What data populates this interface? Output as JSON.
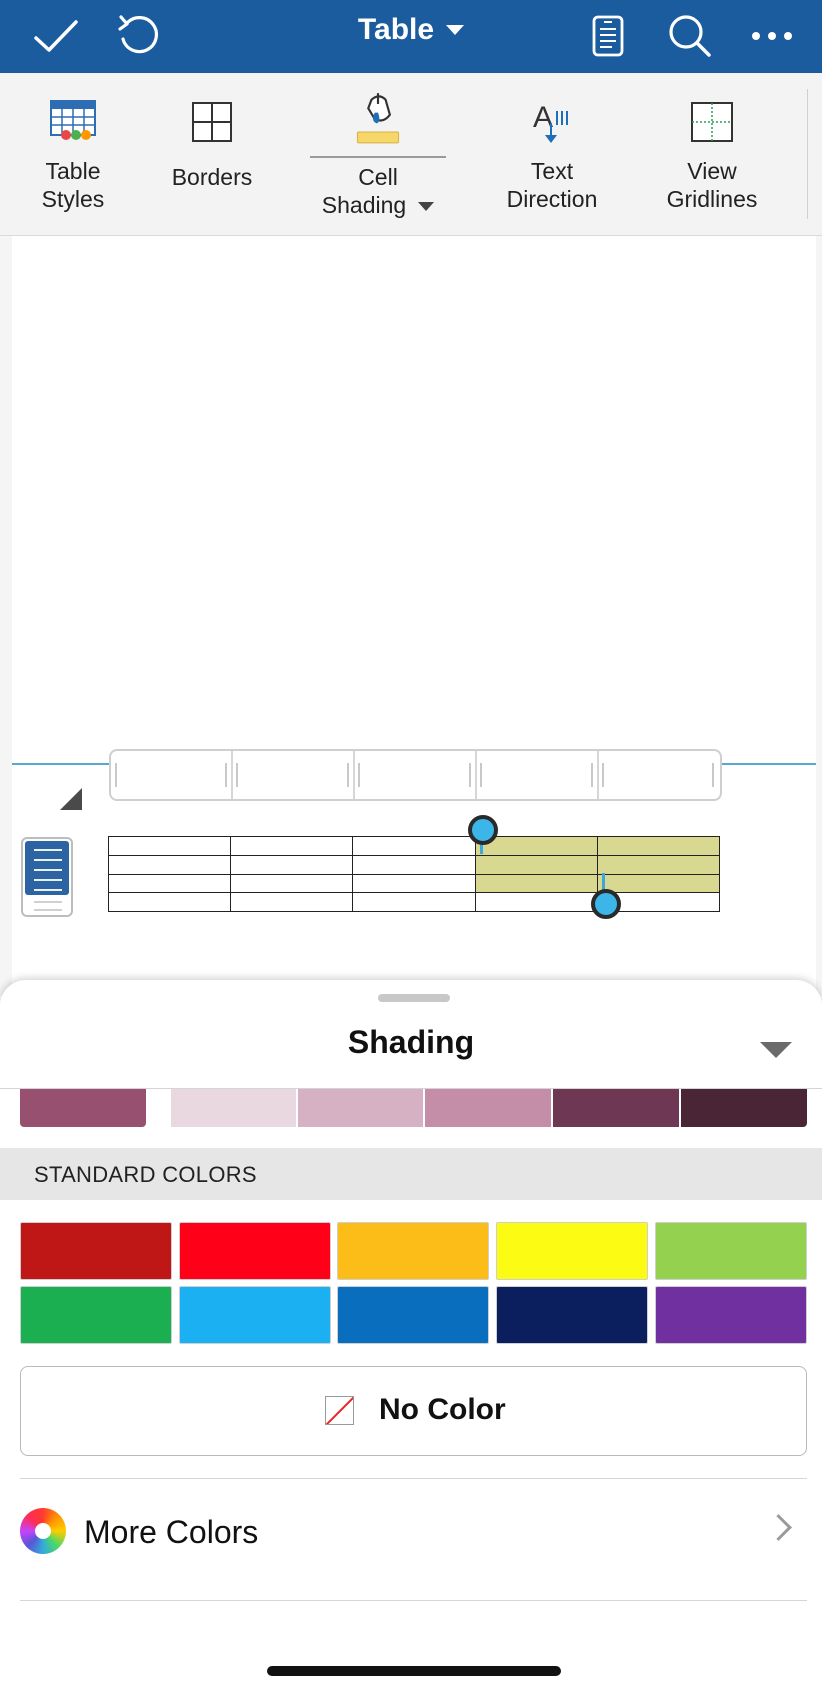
{
  "topbar": {
    "title": "Table",
    "icons": [
      "checkmark-icon",
      "undo-icon",
      "document-icon",
      "search-icon",
      "more-icon"
    ]
  },
  "ribbon": {
    "items": [
      {
        "line1": "Table",
        "line2": "Styles",
        "icon": "table-styles-icon"
      },
      {
        "line1": "Borders",
        "line2": "",
        "icon": "borders-icon"
      },
      {
        "line1": "Cell",
        "line2": "Shading",
        "icon": "cell-shading-icon",
        "selected": true,
        "accent": "#f7d76a"
      },
      {
        "line1": "Text",
        "line2": "Direction",
        "icon": "text-direction-icon"
      },
      {
        "line1": "View",
        "line2": "Gridlines",
        "icon": "view-gridlines-icon"
      }
    ]
  },
  "document": {
    "table": {
      "rows": 4,
      "cols": 5,
      "shaded_cells": [
        [
          0,
          3
        ],
        [
          0,
          4
        ],
        [
          1,
          3
        ],
        [
          1,
          4
        ],
        [
          2,
          3
        ],
        [
          2,
          4
        ]
      ],
      "shade_color": "#d9d890"
    }
  },
  "sheet": {
    "title": "Shading",
    "theme_row": {
      "first": "#97506f",
      "shades": [
        "#ead8e0",
        "#d6b1c3",
        "#c48ea8",
        "#6e3753",
        "#4a2536"
      ]
    },
    "standard_header": "STANDARD COLORS",
    "standard_colors": [
      "#bf1616",
      "#ff0019",
      "#fdbd19",
      "#fcfb14",
      "#94d14f",
      "#1caf52",
      "#1ab0f1",
      "#0a6ebf",
      "#0b1f5e",
      "#7030a0"
    ],
    "no_color_label": "No Color",
    "more_colors_label": "More Colors"
  }
}
